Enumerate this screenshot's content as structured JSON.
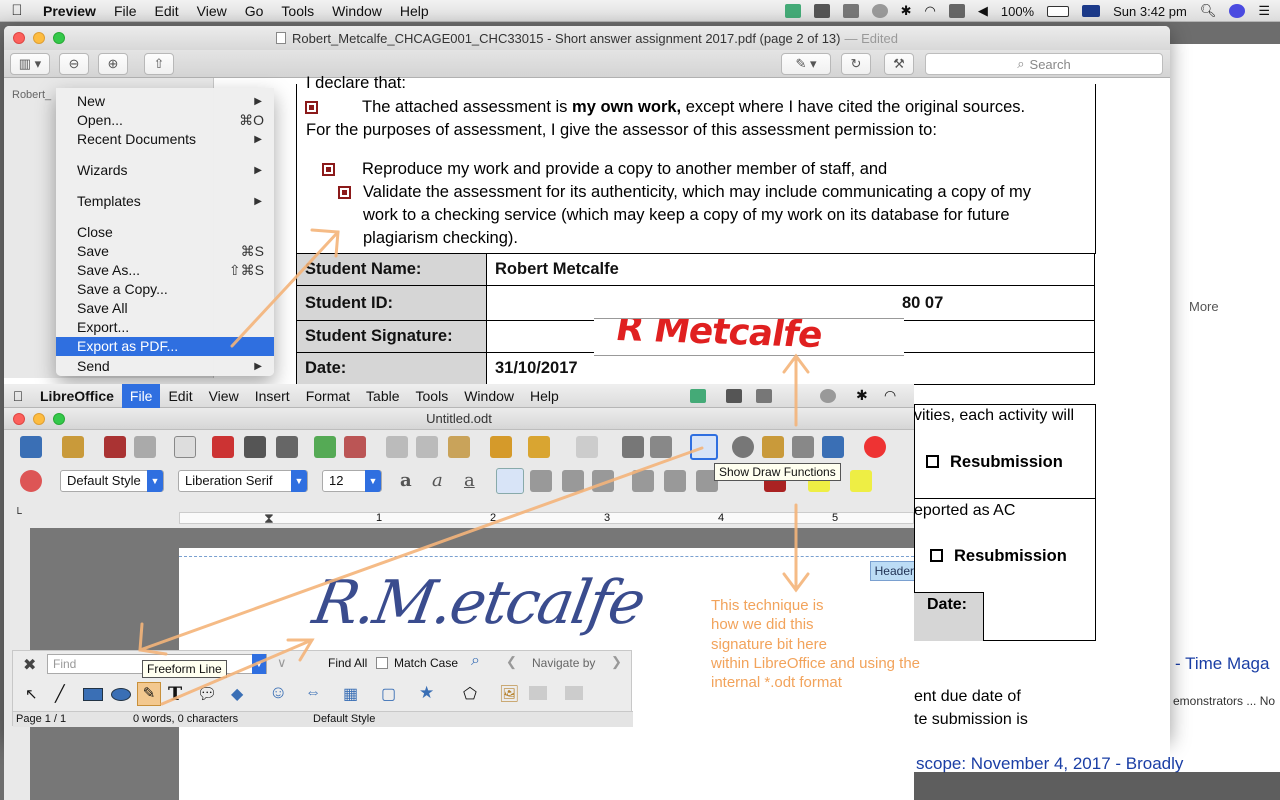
{
  "mac_menubar": {
    "app_name": "Preview",
    "items": [
      "File",
      "Edit",
      "View",
      "Go",
      "Tools",
      "Window",
      "Help"
    ],
    "battery": "100%",
    "clock": "Sun 3:42 pm"
  },
  "preview": {
    "title": "Robert_Metcalfe_CHCAGE001_CHC33015 - Short answer assignment 2017.pdf (page 2 of 13)",
    "edited": "— Edited",
    "search_placeholder": "Search",
    "sidebar_label": "Robert_"
  },
  "document": {
    "declare": "I declare that:",
    "line1_pre": "The attached assessment is ",
    "line1_bold": "my own work,",
    "line1_post": " except where I have cited the original sources.",
    "line2": "For the purposes of assessment, I give the assessor of this assessment permission to:",
    "bullet1": "Reproduce my work and provide a copy to another member of staff, and",
    "bullet2a": "Validate the assessment for its authenticity, which may include communicating a copy of my",
    "bullet2b": "work to a checking service (which may keep a copy of my  work on its database for future",
    "bullet2c": "plagiarism checking).",
    "table": [
      {
        "label": "Student Name:",
        "value": "Robert Metcalfe"
      },
      {
        "label": "Student ID:",
        "value": "80        07"
      },
      {
        "label": "Student Signature:",
        "value": ""
      },
      {
        "label": "Date:",
        "value": "31/10/2017"
      }
    ],
    "signature_text": "R Metcalfe",
    "partial_right_1": "vities, each activity will",
    "resubmission": "Resubmission",
    "partial_right_2": "eported as AC",
    "date_label": "Date:",
    "partial_right_3": "ent due date of",
    "partial_right_4": "te submission is"
  },
  "file_menu": {
    "items": [
      {
        "label": "New",
        "shortcut": "",
        "submenu": true
      },
      {
        "label": "Open...",
        "shortcut": "⌘O",
        "submenu": false
      },
      {
        "label": "Recent Documents",
        "shortcut": "",
        "submenu": true
      },
      {
        "label": "Wizards",
        "shortcut": "",
        "submenu": true
      },
      {
        "label": "Templates",
        "shortcut": "",
        "submenu": true
      },
      {
        "label": "Close",
        "shortcut": "",
        "submenu": false
      },
      {
        "label": "Save",
        "shortcut": "⌘S",
        "submenu": false
      },
      {
        "label": "Save As...",
        "shortcut": "⇧⌘S",
        "submenu": false
      },
      {
        "label": "Save a Copy...",
        "shortcut": "",
        "submenu": false
      },
      {
        "label": "Save All",
        "shortcut": "",
        "submenu": false
      },
      {
        "label": "Export...",
        "shortcut": "",
        "submenu": false
      },
      {
        "label": "Export as PDF...",
        "shortcut": "",
        "submenu": false
      },
      {
        "label": "Send",
        "shortcut": "",
        "submenu": true
      }
    ]
  },
  "libreoffice": {
    "menu": [
      "LibreOffice",
      "File",
      "Edit",
      "View",
      "Insert",
      "Format",
      "Table",
      "Tools",
      "Window",
      "Help"
    ],
    "title": "Untitled.odt",
    "paragraph_style": "Default Style",
    "font_name": "Liberation Serif",
    "font_size": "12",
    "tooltip_draw": "Show Draw Functions",
    "ruler_numbers": [
      "1",
      "2",
      "3",
      "4",
      "5"
    ],
    "header_tag": "Header",
    "handwriting": "R.M.etcalfe",
    "find_placeholder": "Find",
    "tooltip_freeform": "Freeform Line",
    "find_all": "Find All",
    "match_case": "Match Case",
    "navigate_by": "Navigate by",
    "status_page": "Page 1 / 1",
    "status_words": "0 words, 0 characters",
    "status_style": "Default Style"
  },
  "annotation": {
    "lines": [
      "This technique is",
      "how we did this",
      "signature bit here",
      "within LibreOffice and using the",
      "internal *.odt format"
    ]
  },
  "background": {
    "more": "More",
    "link1": "- Time Maga",
    "link2": "emonstrators ... No",
    "link3": "scope: November 4, 2017 - Broadly"
  }
}
